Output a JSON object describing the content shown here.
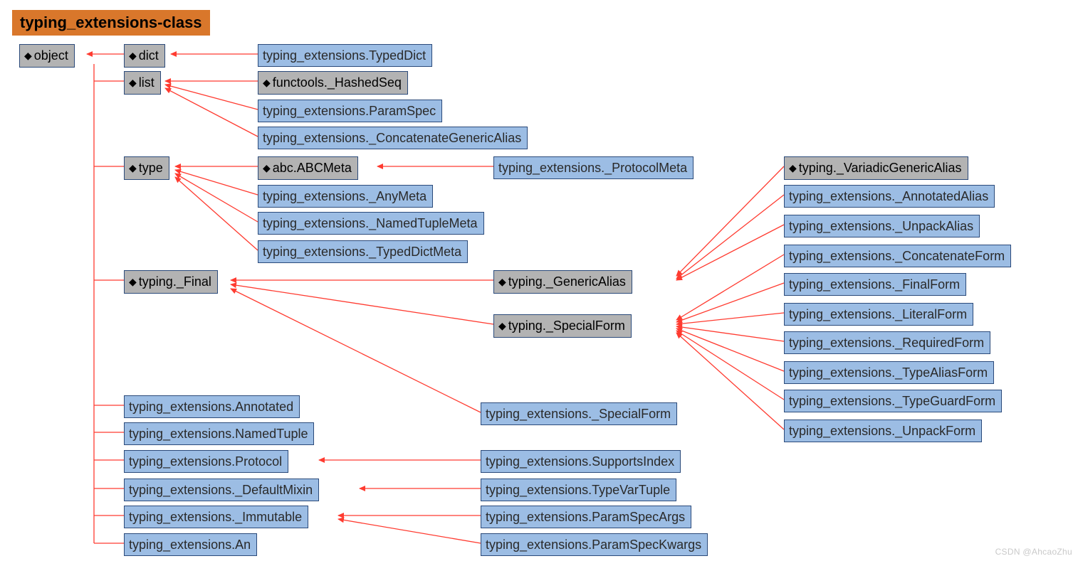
{
  "title": "typing_extensions-class",
  "watermark": "CSDN @AhcaoZhu",
  "nodes": {
    "object": "object",
    "dict": "dict",
    "list": "list",
    "type": "type",
    "typing_Final": "typing._Final",
    "typeddict": "typing_extensions.TypedDict",
    "hashedseq": "functools._HashedSeq",
    "paramspec": "typing_extensions.ParamSpec",
    "concat_generic_alias": "typing_extensions._ConcatenateGenericAlias",
    "abcmeta": "abc.ABCMeta",
    "protocolmeta": "typing_extensions._ProtocolMeta",
    "variadic_ga": "typing._VariadicGenericAlias",
    "anymeta": "typing_extensions._AnyMeta",
    "namedtuplemeta": "typing_extensions._NamedTupleMeta",
    "typeddictmeta": "typing_extensions._TypedDictMeta",
    "genericalias": "typing._GenericAlias",
    "specialform_gray": "typing._SpecialForm",
    "annotatedalias": "typing_extensions._AnnotatedAlias",
    "unpackalias": "typing_extensions._UnpackAlias",
    "concatform": "typing_extensions._ConcatenateForm",
    "finalform": "typing_extensions._FinalForm",
    "literalform": "typing_extensions._LiteralForm",
    "requiredform": "typing_extensions._RequiredForm",
    "typealiasform": "typing_extensions._TypeAliasForm",
    "typeguardform": "typing_extensions._TypeGuardForm",
    "unpackform": "typing_extensions._UnpackForm",
    "specialform_blue": "typing_extensions._SpecialForm",
    "annotated": "typing_extensions.Annotated",
    "namedtuple": "typing_extensions.NamedTuple",
    "protocol": "typing_extensions.Protocol",
    "supportsindex": "typing_extensions.SupportsIndex",
    "defaultmixin": "typing_extensions._DefaultMixin",
    "typevartuple": "typing_extensions.TypeVarTuple",
    "immutable": "typing_extensions._Immutable",
    "paramspecargs": "typing_extensions.ParamSpecArgs",
    "paramspeckwargs": "typing_extensions.ParamSpecKwargs",
    "an": "typing_extensions.An"
  }
}
